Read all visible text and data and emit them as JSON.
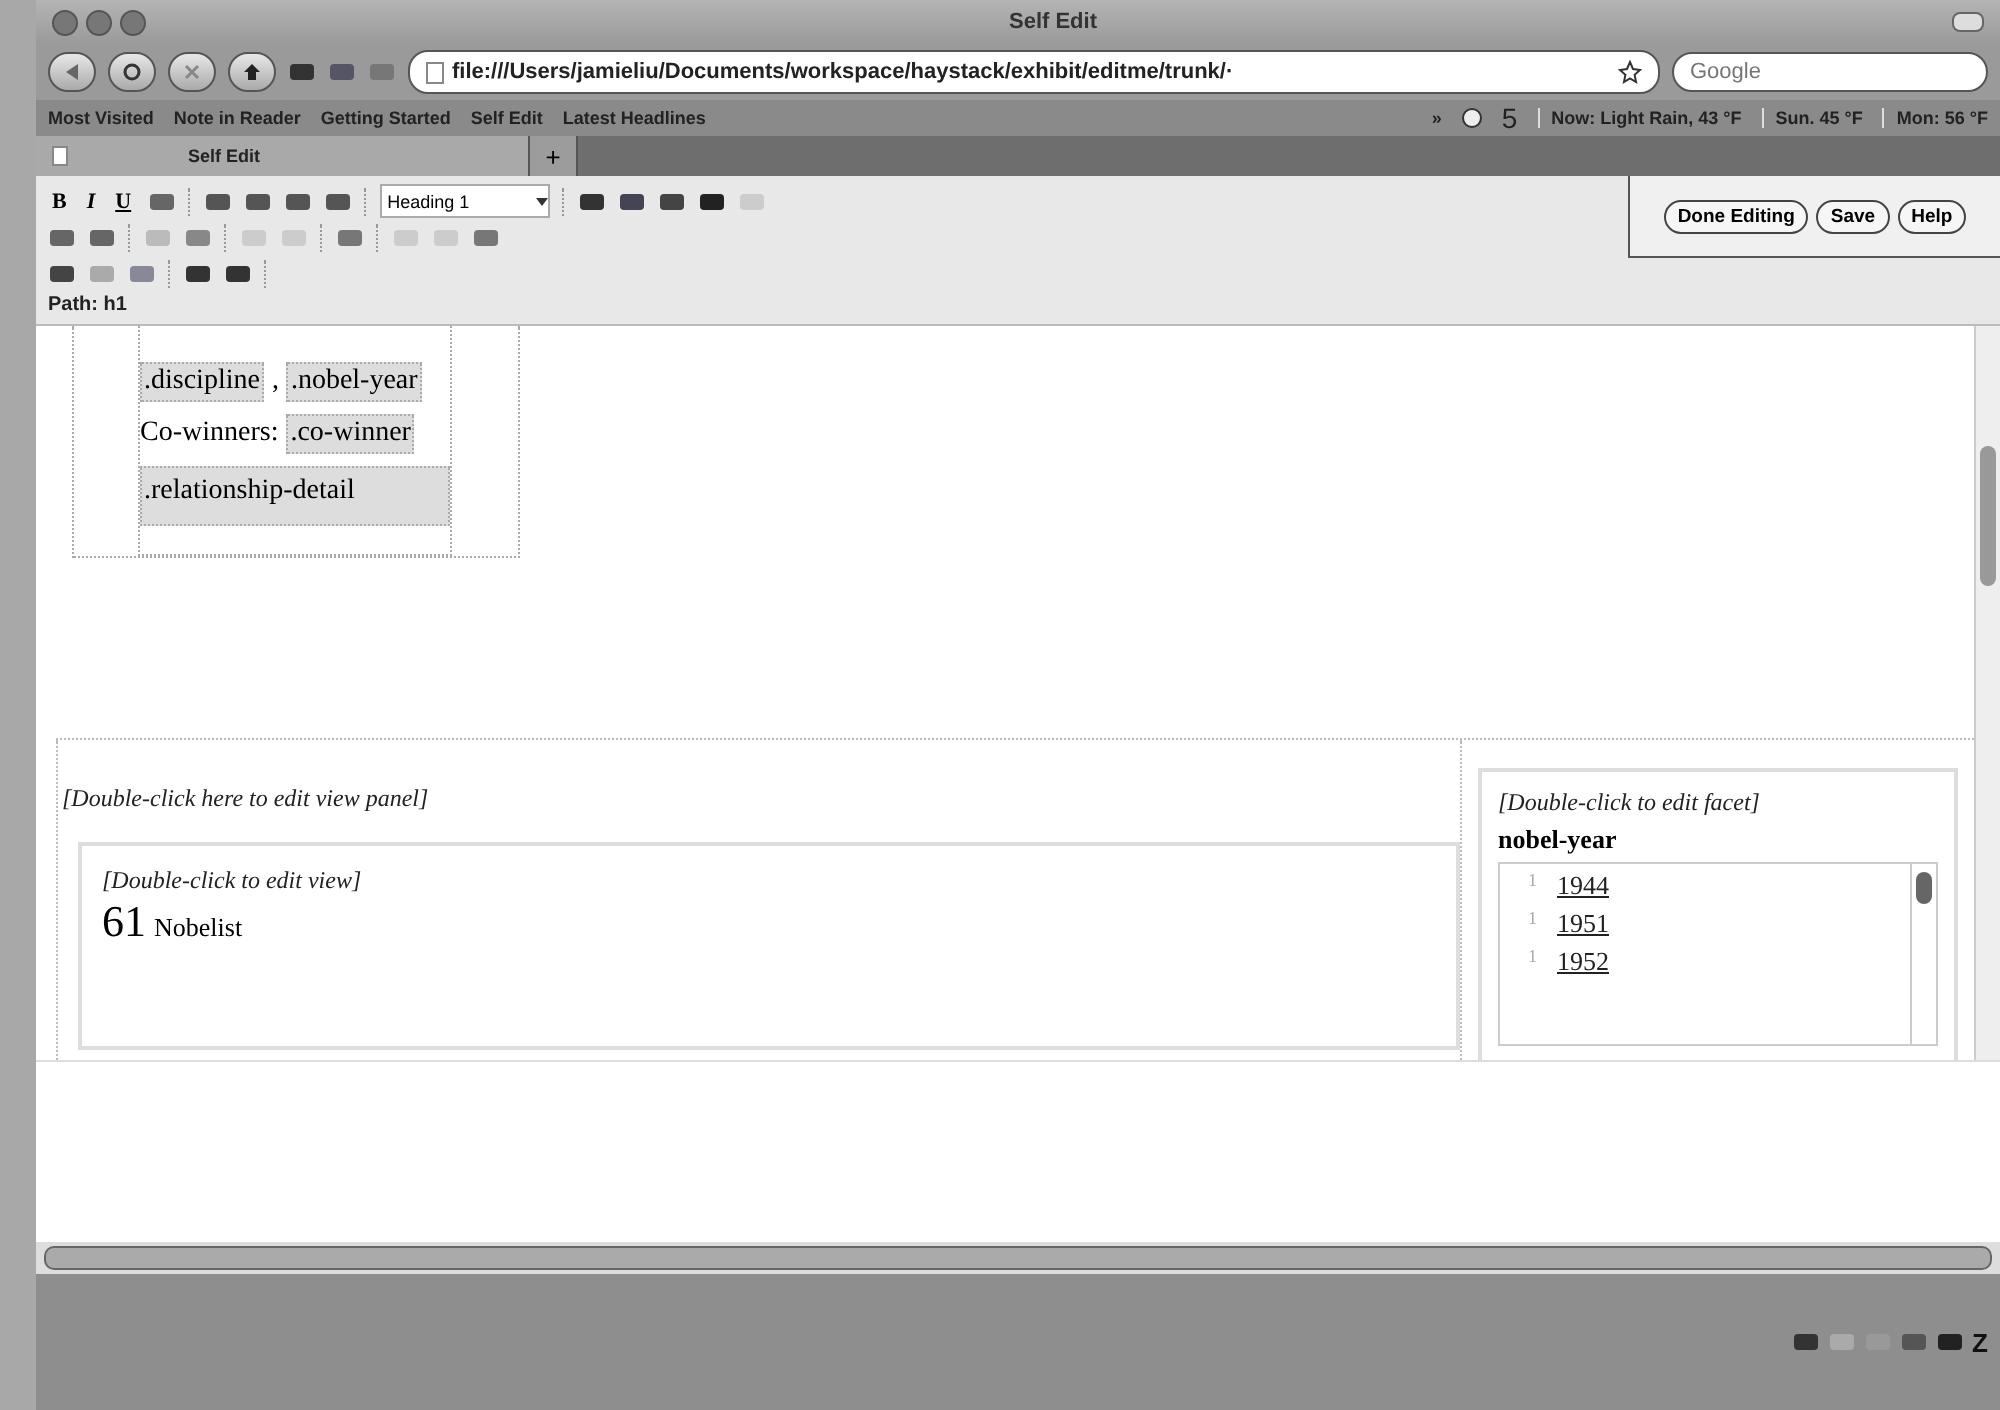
{
  "window": {
    "title": "Self Edit"
  },
  "navigation": {
    "url": "file:///Users/jamieliu/Documents/workspace/haystack/exhibit/editme/trunk/·",
    "search_placeholder": "Google"
  },
  "bookmarks": {
    "items": [
      "Most Visited",
      "Note in Reader",
      "Getting Started",
      "Self Edit",
      "Latest Headlines"
    ],
    "overflow": "»",
    "counter": "5",
    "weather": [
      "Now: Light Rain, 43 °F",
      "Sun. 45 °F",
      "Mon: 56 °F"
    ]
  },
  "tabs": [
    {
      "label": "Self Edit",
      "selected": true
    }
  ],
  "new_tab": "+",
  "editor_toolbar": {
    "format_buttons": [
      "B",
      "I",
      "U"
    ],
    "block_format": "Heading 1",
    "path": "Path: h1"
  },
  "edit_buttons": [
    "Done Editing",
    "Save",
    "Help"
  ],
  "lens": {
    "lines": [
      {
        "kind": "pair",
        "first": ".discipline",
        "separator": ",",
        "second": ".nobel-year"
      },
      {
        "kind": "labeled",
        "label": "Co-winners:",
        "field": ".co-winner"
      },
      {
        "kind": "block",
        "field": ".relationship-detail"
      }
    ]
  },
  "view_panel": {
    "hint": "[Double-click here to edit view panel]",
    "view": {
      "hint": "[Double-click to edit view]",
      "count": "61",
      "label": "Nobelist"
    }
  },
  "facet": {
    "hint": "[Double-click to edit facet]",
    "title": "nobel-year",
    "items": [
      {
        "count": "1",
        "label": "1944"
      },
      {
        "count": "1",
        "label": "1951"
      },
      {
        "count": "1",
        "label": "1952"
      }
    ]
  },
  "status_bar": {
    "text": "Z"
  }
}
